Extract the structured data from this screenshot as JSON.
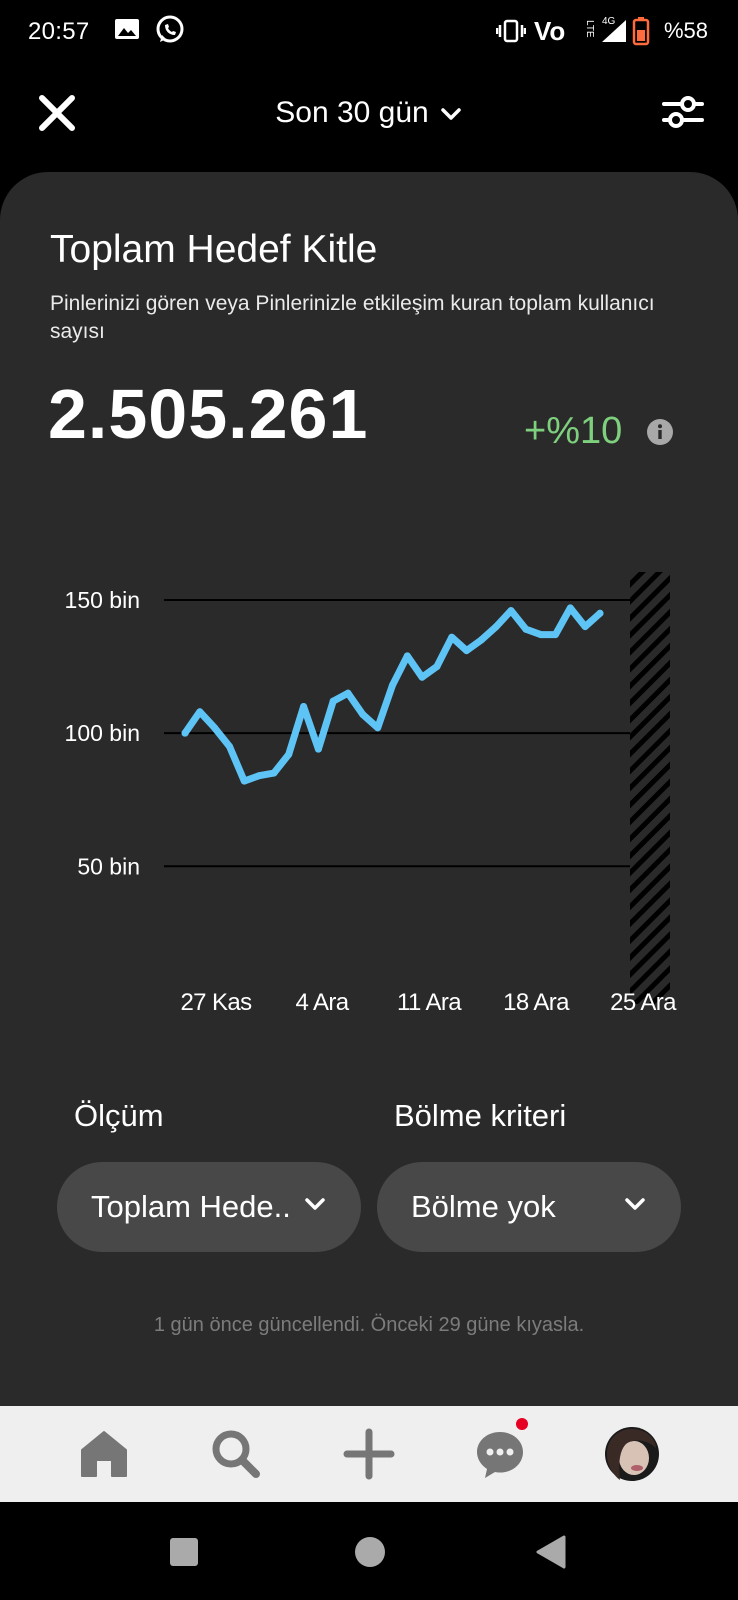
{
  "status_bar": {
    "time": "20:57",
    "network": "Vo",
    "network_sub": "LTE",
    "signal_label": "4G",
    "battery": "%58",
    "left_icons": [
      "image-icon",
      "whatsapp-icon"
    ]
  },
  "header": {
    "range_label": "Son 30 gün"
  },
  "card": {
    "title": "Toplam Hedef Kitle",
    "description": "Pinlerinizi gören veya Pinlerinizle etkileşim kuran toplam kullanıcı sayısı",
    "value": "2.505.261",
    "change": "+%10"
  },
  "chart_data": {
    "type": "line",
    "x_tick_labels": [
      "27 Kas",
      "4 Ara",
      "11 Ara",
      "18 Ara",
      "25 Ara"
    ],
    "y_tick_labels": [
      "150  bin",
      "100  bin",
      "50  bin"
    ],
    "y_ticks": [
      150,
      100,
      50
    ],
    "ylim": [
      25,
      165
    ],
    "grid": true,
    "series": [
      {
        "color": "#5ec4f5",
        "values": [
          100,
          108,
          102,
          95,
          82,
          84,
          85,
          92,
          110,
          94,
          112,
          115,
          107,
          102,
          118,
          129,
          121,
          125,
          136,
          131,
          135,
          140,
          146,
          139,
          137,
          137,
          147,
          140,
          145
        ]
      }
    ],
    "projection_hatched": true
  },
  "controls": {
    "metric_label": "Ölçüm",
    "metric_value": "Toplam Hede..",
    "split_label": "Bölme kriteri",
    "split_value": "Bölme yok"
  },
  "footnote": "1 gün önce güncellendi. Önceki 29 güne kıyasla.",
  "bottom_nav": [
    "home-icon",
    "search-icon",
    "add-icon",
    "messages-icon",
    "profile-avatar"
  ]
}
